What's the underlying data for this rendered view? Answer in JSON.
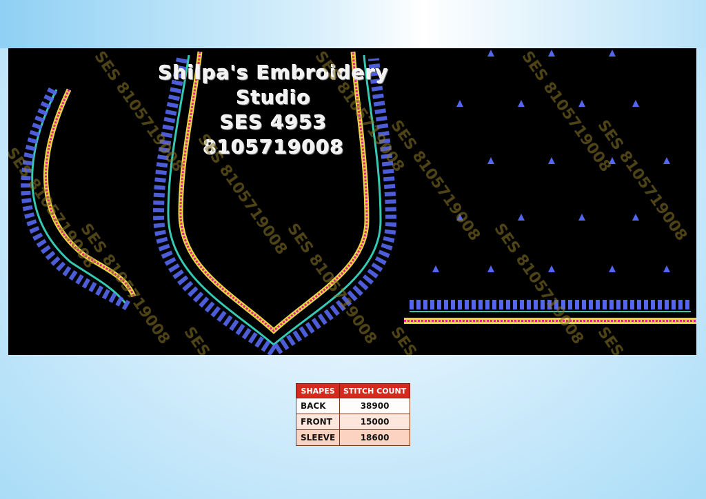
{
  "header": {
    "line1": "Shilpa's Embroidery Studio",
    "line2": "SES 4953",
    "line3": "8105719008"
  },
  "watermark_text": "SES 8105719008",
  "colors": {
    "panel_bg": "#000000",
    "leaf_blue": "#5566ee",
    "leaf_teal": "#35c9b3",
    "border_magenta": "#e0208f",
    "border_gold": "#e8d640",
    "table_header": "#d52b1e"
  },
  "stitch_table": {
    "headers": [
      "SHAPES",
      "STITCH COUNT"
    ],
    "rows": [
      {
        "shape": "BACK",
        "count": "38900"
      },
      {
        "shape": "FRONT",
        "count": "15000"
      },
      {
        "shape": "SLEEVE",
        "count": "18600"
      }
    ]
  }
}
